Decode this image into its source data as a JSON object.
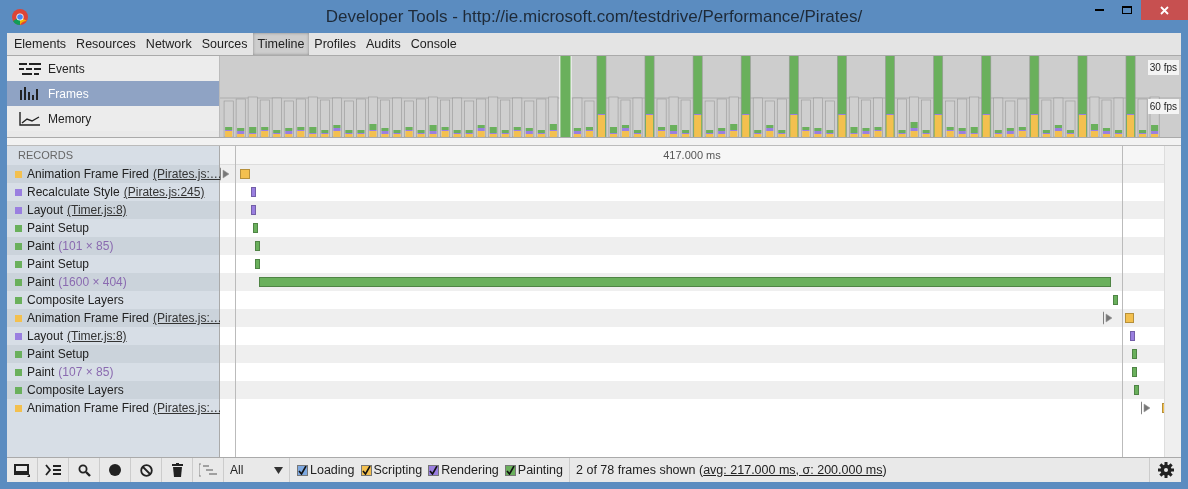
{
  "window": {
    "title": "Developer Tools - http://ie.microsoft.com/testdrive/Performance/Pirates/"
  },
  "tabs": [
    {
      "label": "Elements",
      "selected": false
    },
    {
      "label": "Resources",
      "selected": false
    },
    {
      "label": "Network",
      "selected": false
    },
    {
      "label": "Sources",
      "selected": false
    },
    {
      "label": "Timeline",
      "selected": true
    },
    {
      "label": "Profiles",
      "selected": false
    },
    {
      "label": "Audits",
      "selected": false
    },
    {
      "label": "Console",
      "selected": false
    }
  ],
  "modes": [
    {
      "label": "Events",
      "kind": "events",
      "selected": false
    },
    {
      "label": "Frames",
      "kind": "frames",
      "selected": true
    },
    {
      "label": "Memory",
      "kind": "memory",
      "selected": false
    }
  ],
  "overview": {
    "markers": [
      "30 fps",
      "60 fps"
    ]
  },
  "records_header": "RECORDS",
  "time_label": "417.000 ms",
  "records": [
    {
      "title": "Animation Frame Fired",
      "link": "(Pirates.js:…",
      "color": "#f3c04f",
      "expandable": true
    },
    {
      "title": "Recalculate Style",
      "link": "(Pirates.js:245)",
      "color": "#9a7fe0",
      "expandable": false
    },
    {
      "title": "Layout",
      "link": "(Timer.js:8)",
      "color": "#9a7fe0",
      "expandable": false
    },
    {
      "title": "Paint Setup",
      "color": "#6ab05c",
      "expandable": false
    },
    {
      "title": "Paint",
      "detail": "(101 × 85)",
      "color": "#6ab05c",
      "expandable": false
    },
    {
      "title": "Paint Setup",
      "color": "#6ab05c",
      "expandable": false
    },
    {
      "title": "Paint",
      "detail": "(1600 × 404)",
      "color": "#6ab05c",
      "expandable": false
    },
    {
      "title": "Composite Layers",
      "color": "#6ab05c",
      "expandable": false
    },
    {
      "title": "Animation Frame Fired",
      "link": "(Pirates.js:…",
      "color": "#f3c04f",
      "expandable": true
    },
    {
      "title": "Layout",
      "link": "(Timer.js:8)",
      "color": "#9a7fe0",
      "expandable": false
    },
    {
      "title": "Paint Setup",
      "color": "#6ab05c",
      "expandable": false
    },
    {
      "title": "Paint",
      "detail": "(107 × 85)",
      "color": "#6ab05c",
      "expandable": false
    },
    {
      "title": "Composite Layers",
      "color": "#6ab05c",
      "expandable": false
    },
    {
      "title": "Animation Frame Fired",
      "link": "(Pirates.js:…",
      "color": "#f3c04f",
      "expandable": true
    }
  ],
  "status_bar": {
    "filter": "All",
    "categories": [
      {
        "label": "Loading",
        "checked": true,
        "color": "#7ea9e1"
      },
      {
        "label": "Scripting",
        "checked": true,
        "color": "#f3c04f"
      },
      {
        "label": "Rendering",
        "checked": true,
        "color": "#9a7fe0"
      },
      {
        "label": "Painting",
        "checked": true,
        "color": "#6ab05c"
      }
    ],
    "summary": "2 of 78 frames shown (",
    "summary_link": "avg: 217.000 ms, σ: 200.000 ms",
    "summary_end": ")"
  }
}
